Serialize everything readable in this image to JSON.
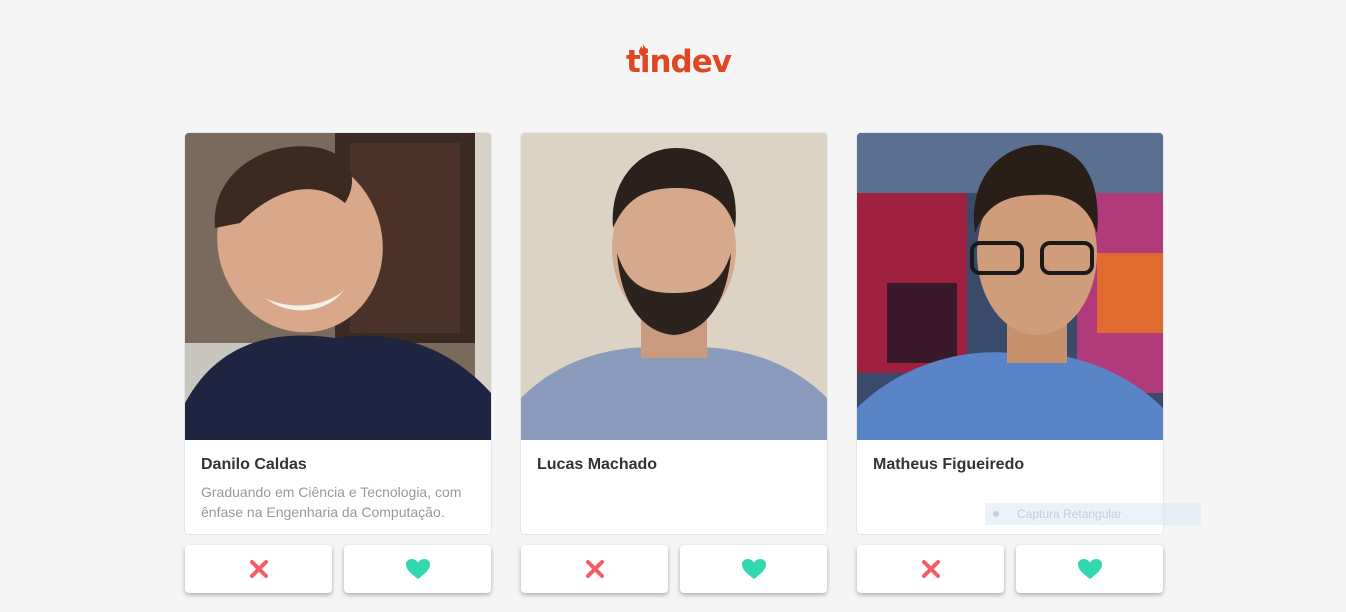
{
  "brand": {
    "logo_text": "tindev",
    "color": "#df4723"
  },
  "developers": [
    {
      "name": "Danilo Caldas",
      "bio": "Graduando em Ciência e Tecnologia, com ênfase na Engenharia da Computação.",
      "dislike_icon": "close-icon",
      "like_icon": "heart-icon"
    },
    {
      "name": "Lucas Machado",
      "bio": "",
      "dislike_icon": "close-icon",
      "like_icon": "heart-icon"
    },
    {
      "name": "Matheus Figueiredo",
      "bio": "",
      "dislike_icon": "close-icon",
      "like_icon": "heart-icon"
    }
  ],
  "colors": {
    "dislike": "#f75a68",
    "like": "#34d7b0",
    "name": "#333333",
    "bio": "#999999"
  },
  "overlay": {
    "label": "Captura Retangular"
  }
}
